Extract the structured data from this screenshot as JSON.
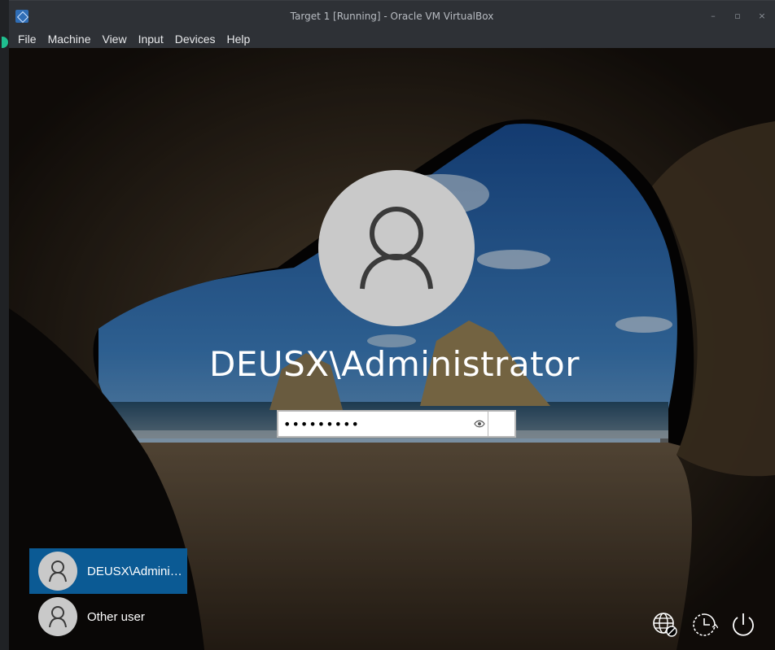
{
  "window": {
    "title": "Target 1 [Running] - Oracle VM VirtualBox",
    "controls": [
      "–",
      "▫",
      "×"
    ]
  },
  "menu": [
    "File",
    "Machine",
    "View",
    "Input",
    "Devices",
    "Help"
  ],
  "login": {
    "username": "DEUSX\\Administrator",
    "password_masked": "•••••••••",
    "submit_icon": "arrow-right-icon",
    "reveal_icon": "eye-icon"
  },
  "user_list": [
    {
      "name": "DEUSX\\Admini…",
      "selected": true
    },
    {
      "name": "Other user",
      "selected": false
    }
  ],
  "system_icons": [
    "network-icon",
    "ease-of-access-icon",
    "power-icon"
  ],
  "colors": {
    "selected_tile": "#0b5a94",
    "avatar_bg": "#c9c9c9",
    "titlebar": "#2e3136"
  }
}
